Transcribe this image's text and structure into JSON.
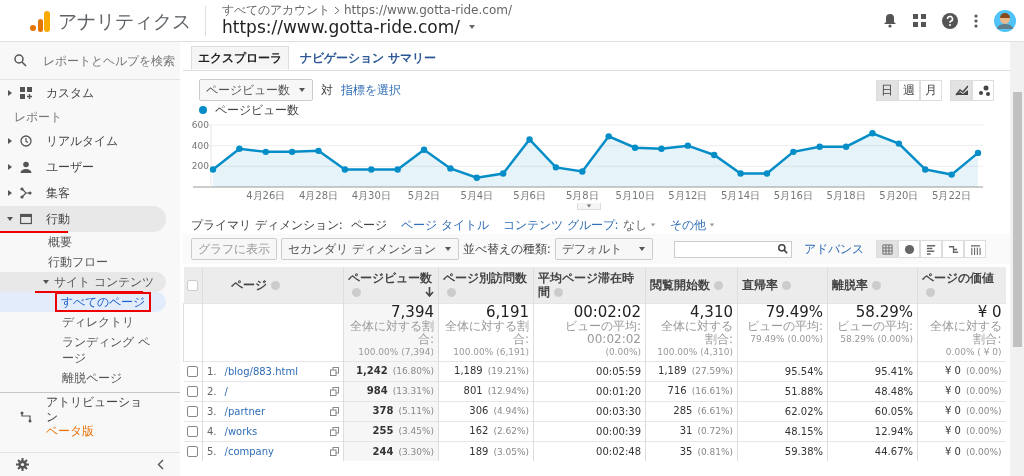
{
  "header": {
    "app_title": "アナリティクス",
    "breadcrumb": [
      "すべてのアカウント",
      "https://www.gotta-ride.com/"
    ],
    "property": "https://www.gotta-ride.com/"
  },
  "sidebar": {
    "search_placeholder": "レポートとヘルプを検索",
    "items": [
      {
        "kind": "nav",
        "label": "カスタム",
        "expanded": false,
        "selected": false
      },
      {
        "kind": "section",
        "label": "レポート"
      },
      {
        "kind": "nav",
        "label": "リアルタイム",
        "expanded": false,
        "selected": false
      },
      {
        "kind": "nav",
        "label": "ユーザー",
        "expanded": false,
        "selected": false
      },
      {
        "kind": "nav",
        "label": "集客",
        "expanded": false,
        "selected": false
      },
      {
        "kind": "nav",
        "label": "行動",
        "expanded": true,
        "selected": true,
        "red_underline": true,
        "children": [
          {
            "label": "概要",
            "selected": false
          },
          {
            "label": "行動フロー",
            "selected": false
          },
          {
            "label": "サイト コンテンツ",
            "expanded": true,
            "selected": true,
            "red_underline": true,
            "children": [
              {
                "label": "すべてのページ",
                "selected": true,
                "red_box": true
              },
              {
                "label": "ディレクトリ",
                "selected": false
              },
              {
                "label": "ランディング ページ",
                "selected": false
              },
              {
                "label": "離脱ページ",
                "selected": false
              }
            ]
          }
        ]
      },
      {
        "kind": "nav",
        "label": "アトリビューション",
        "badge": "ベータ版",
        "selected": false
      }
    ]
  },
  "tabs": [
    {
      "label": "エクスプローラ",
      "selected": true
    },
    {
      "label": "ナビゲーション サマリー",
      "selected": false
    }
  ],
  "metric": {
    "dropdown": "ページビュー数",
    "versus": "対",
    "select_link": "指標を選択"
  },
  "periods": [
    {
      "label": "日",
      "selected": true
    },
    {
      "label": "週",
      "selected": false
    },
    {
      "label": "月",
      "selected": false
    }
  ],
  "chart_modes": [
    {
      "selected": true
    },
    {
      "selected": false
    }
  ],
  "chart": {
    "chart_data": {
      "type": "area",
      "categories": [
        null,
        null,
        "4月26日",
        null,
        "4月28日",
        null,
        "4月30日",
        null,
        "5月2日",
        null,
        "5月4日",
        null,
        "5月6日",
        null,
        "5月8日",
        null,
        "5月10日",
        null,
        "5月12日",
        null,
        "5月14日",
        null,
        "5月16日",
        null,
        "5月18日",
        null,
        "5月20日",
        null,
        "5月22日",
        null
      ],
      "series": [
        {
          "name": "ページビュー数",
          "color": "#058dc7",
          "values": [
            170,
            370,
            340,
            340,
            350,
            170,
            170,
            170,
            360,
            180,
            90,
            130,
            460,
            190,
            150,
            490,
            380,
            370,
            400,
            310,
            130,
            130,
            340,
            390,
            390,
            520,
            420,
            170,
            120,
            330
          ]
        }
      ],
      "ylim": [
        0,
        600
      ],
      "yticks": [
        200,
        400,
        600
      ]
    }
  },
  "dimension": {
    "label": "プライマリ ディメンション:",
    "options": [
      {
        "label": "ページ",
        "selected": true,
        "dropdown": false
      },
      {
        "label": "ページ タイトル",
        "selected": false,
        "dropdown": false
      },
      {
        "label": "コンテンツ グループ:",
        "value": "なし",
        "selected": false,
        "dropdown": true
      },
      {
        "label": "その他",
        "selected": false,
        "dropdown": true
      }
    ]
  },
  "toolbar": {
    "plot_button": {
      "label": "グラフに表示",
      "disabled": true
    },
    "secondary": "セカンダリ ディメンション",
    "sort_label": "並べ替えの種類:",
    "sort": "デフォルト",
    "advanced": "アドバンス",
    "views": [
      {
        "selected": true
      },
      {
        "selected": false
      },
      {
        "selected": false
      },
      {
        "selected": false
      },
      {
        "selected": false
      }
    ]
  },
  "table": {
    "select_all": {
      "checked": false
    },
    "columns": [
      {
        "label": "ページ",
        "sorted": false
      },
      {
        "label": "ページビュー数",
        "sorted": true
      },
      {
        "label": "ページ別訪問数",
        "sorted": false
      },
      {
        "label": "平均ページ滞在時間",
        "sorted": false
      },
      {
        "label": "閲覧開始数",
        "sorted": false
      },
      {
        "label": "直帰率",
        "sorted": false
      },
      {
        "label": "離脱率",
        "sorted": false
      },
      {
        "label": "ページの価値",
        "sorted": false
      }
    ],
    "totals": [
      {
        "value": "7,394",
        "lines": [
          "全体に対する割合:",
          "100.00% (7,394)"
        ]
      },
      {
        "value": "6,191",
        "lines": [
          "全体に対する割合:",
          "100.00% (6,191)"
        ]
      },
      {
        "value": "00:02:02",
        "lines": [
          "ビューの平均: 00:02:02",
          "(0.00%)"
        ]
      },
      {
        "value": "4,310",
        "lines": [
          "全体に対する割合:",
          "100.00% (4,310)"
        ]
      },
      {
        "value": "79.49%",
        "lines": [
          "ビューの平均:",
          "79.49% (0.00%)"
        ]
      },
      {
        "value": "58.29%",
        "lines": [
          "ビューの平均:",
          "58.29% (0.00%)"
        ]
      },
      {
        "value": "¥ 0",
        "lines": [
          "全体に対する割合:",
          "0.00% ( ¥ 0)"
        ]
      }
    ],
    "rows": [
      {
        "checked": false,
        "cells": [
          [
            "1.",
            "/blog/883.html"
          ],
          [
            "1,242",
            "(16.80%)"
          ],
          [
            "1,189",
            "(19.21%)"
          ],
          [
            "00:05:59"
          ],
          [
            "1,189",
            "(27.59%)"
          ],
          [
            "95.54%"
          ],
          [
            "95.41%"
          ],
          [
            "¥ 0",
            "(0.00%)"
          ]
        ]
      },
      {
        "checked": false,
        "cells": [
          [
            "2.",
            "/"
          ],
          [
            "984",
            "(13.31%)"
          ],
          [
            "801",
            "(12.94%)"
          ],
          [
            "00:01:20"
          ],
          [
            "716",
            "(16.61%)"
          ],
          [
            "51.88%"
          ],
          [
            "48.48%"
          ],
          [
            "¥ 0",
            "(0.00%)"
          ]
        ]
      },
      {
        "checked": false,
        "cells": [
          [
            "3.",
            "/partner"
          ],
          [
            "378",
            "(5.11%)"
          ],
          [
            "306",
            "(4.94%)"
          ],
          [
            "00:03:30"
          ],
          [
            "285",
            "(6.61%)"
          ],
          [
            "62.02%"
          ],
          [
            "60.05%"
          ],
          [
            "¥ 0",
            "(0.00%)"
          ]
        ]
      },
      {
        "checked": false,
        "cells": [
          [
            "4.",
            "/works"
          ],
          [
            "255",
            "(3.45%)"
          ],
          [
            "162",
            "(2.62%)"
          ],
          [
            "00:00:39"
          ],
          [
            "31",
            "(0.72%)"
          ],
          [
            "48.15%"
          ],
          [
            "12.94%"
          ],
          [
            "¥ 0",
            "(0.00%)"
          ]
        ]
      },
      {
        "checked": false,
        "cells": [
          [
            "5.",
            "/company"
          ],
          [
            "244",
            "(3.30%)"
          ],
          [
            "189",
            "(3.05%)"
          ],
          [
            "00:02:48"
          ],
          [
            "35",
            "(0.81%)"
          ],
          [
            "59.38%"
          ],
          [
            "44.67%"
          ],
          [
            "¥ 0",
            "(0.00%)"
          ]
        ]
      }
    ]
  }
}
